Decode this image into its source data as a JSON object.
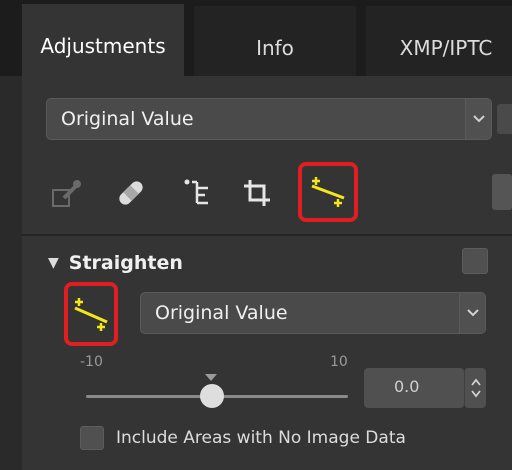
{
  "tabs": [
    {
      "label": "Adjustments",
      "active": true
    },
    {
      "label": "Info",
      "active": false
    },
    {
      "label": "XMP/IPTC",
      "active": false
    }
  ],
  "top_dropdown": {
    "value": "Original Value"
  },
  "toolbar": {
    "tools": [
      {
        "icon": "color-picker-icon"
      },
      {
        "icon": "bandage-icon"
      },
      {
        "icon": "level-tree-icon"
      },
      {
        "icon": "crop-icon"
      },
      {
        "icon": "straighten-icon",
        "highlighted": true
      }
    ]
  },
  "straighten": {
    "title": "Straighten",
    "dropdown_value": "Original Value",
    "range_min": "-10",
    "range_max": "10",
    "slider_value": 0.0,
    "input_value": "0.0",
    "checkbox_label": "Include Areas with No Image Data",
    "checkbox_checked": false
  },
  "colors": {
    "highlight": "#e02020",
    "icon_yellow": "#f5e61a",
    "panel": "#343434"
  }
}
